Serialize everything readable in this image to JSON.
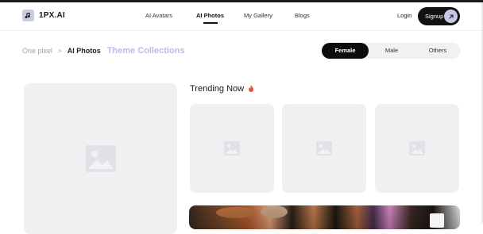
{
  "brand": {
    "name": "1PX.AI",
    "logo_icon": "music-note-icon"
  },
  "nav": {
    "items": [
      {
        "label": "AI Avatars",
        "active": false
      },
      {
        "label": "AI Photos",
        "active": true
      },
      {
        "label": "My Gallery",
        "active": false
      },
      {
        "label": "Blogs",
        "active": false
      }
    ],
    "login": "Login",
    "signup": "Signup",
    "signup_icon": "arrow-up-right-icon"
  },
  "breadcrumb": {
    "items": [
      "One pixel",
      "AI Photos"
    ],
    "separator": ">",
    "section": "Theme Collections"
  },
  "gender_filter": {
    "options": [
      "Female",
      "Male",
      "Others"
    ],
    "selected": "Female"
  },
  "trending": {
    "title": "Trending Now",
    "icon": "fire-icon",
    "accent": "#e2533a"
  },
  "colors": {
    "accent": "#b7bfe3",
    "dark": "#121212",
    "placeholder": "#f0f0f2"
  }
}
